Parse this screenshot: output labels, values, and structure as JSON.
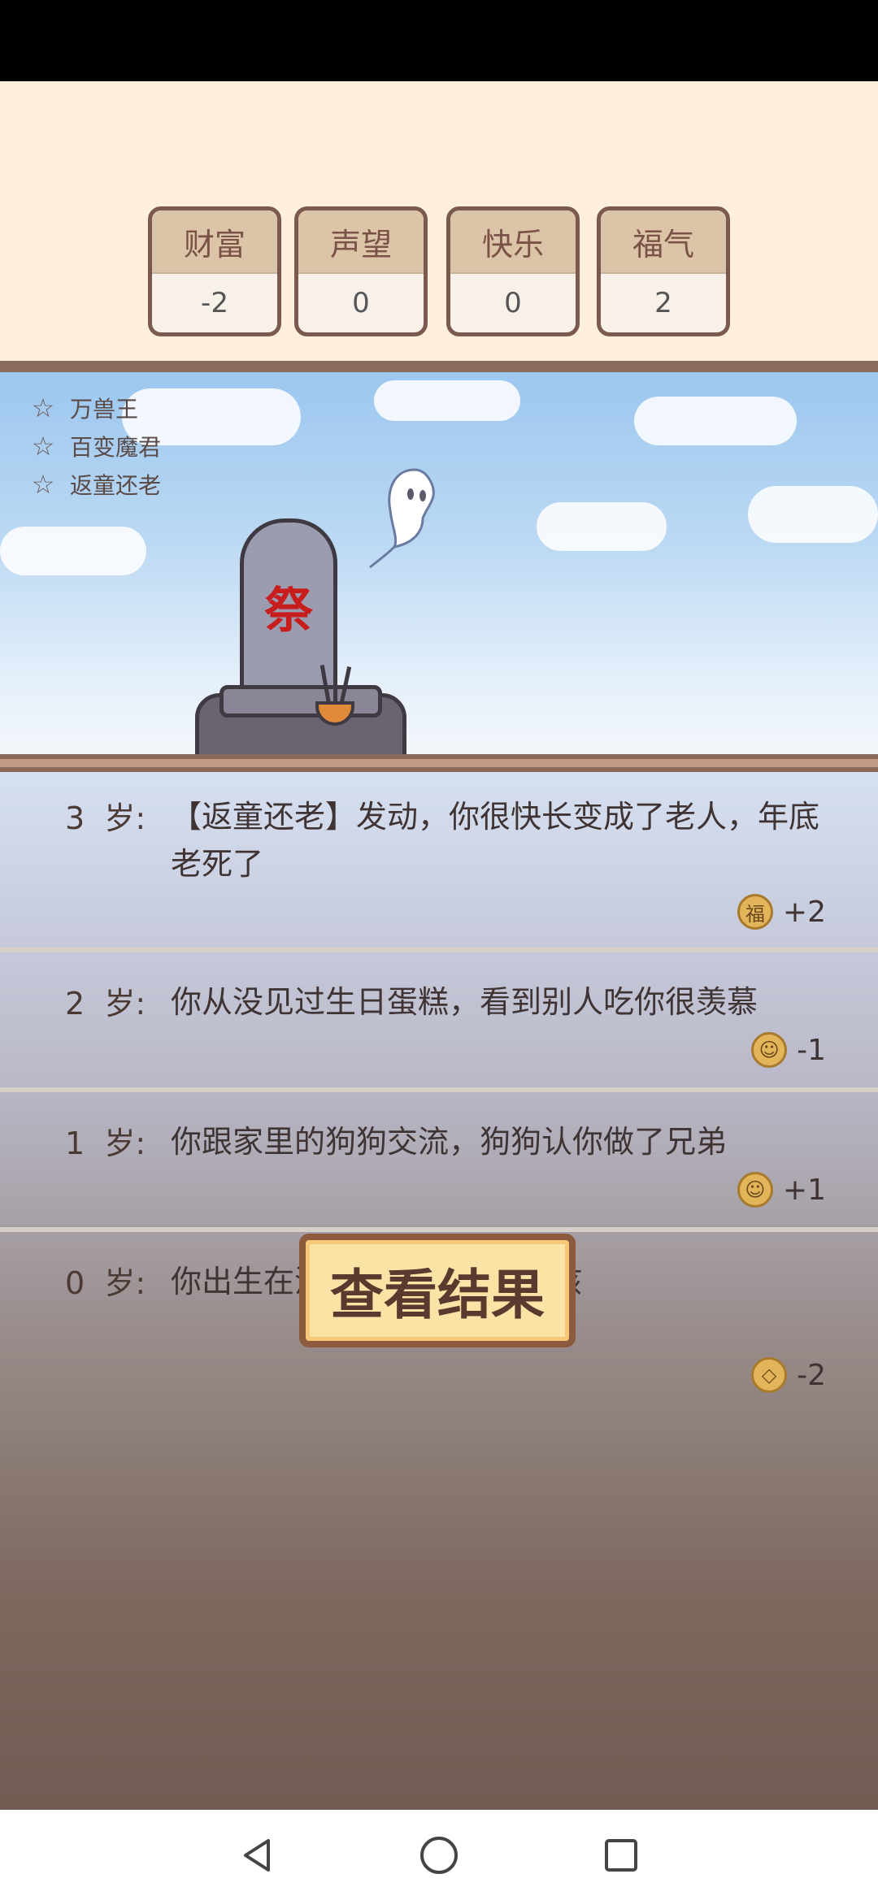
{
  "stats": [
    {
      "label": "财富",
      "value": "-2"
    },
    {
      "label": "声望",
      "value": "0"
    },
    {
      "label": "快乐",
      "value": "0"
    },
    {
      "label": "福气",
      "value": "2"
    }
  ],
  "traits": [
    "万兽王",
    "百变魔君",
    "返童还老"
  ],
  "tombstone_char": "祭",
  "log": [
    {
      "age": "3  岁:",
      "text": "【返童还老】发动，你很快长变成了老人，年底老死了",
      "delta_icon": "福",
      "delta": "+2"
    },
    {
      "age": "2  岁:",
      "text": "你从没见过生日蛋糕，看到别人吃你很羡慕",
      "delta_icon": "☺",
      "delta": "-1"
    },
    {
      "age": "1  岁:",
      "text": "你跟家里的狗狗交流，狗狗认你做了兄弟",
      "delta_icon": "☺",
      "delta": "+1"
    },
    {
      "age": "0  岁:",
      "text": "你出生在流浪家庭， 是个男孩",
      "delta_icon": "◇",
      "delta": "-2"
    }
  ],
  "result_button": "查看结果",
  "colors": {
    "accent_brown": "#8a6a5c",
    "stone_char_red": "#c81d1d"
  }
}
